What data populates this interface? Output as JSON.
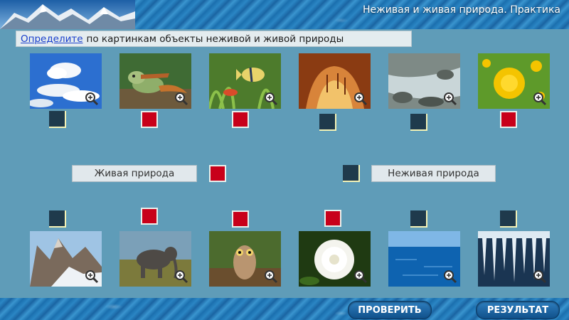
{
  "header": {
    "title": "Неживая и живая природа. Практика"
  },
  "instruction": {
    "link": "Определите",
    "text": "по картинкам объекты неживой и живой природы"
  },
  "labels": {
    "living": "Живая природа",
    "nonliving": "Неживая природа"
  },
  "legend_markers": {
    "living": "red",
    "nonliving": "dark"
  },
  "top_row": [
    {
      "name": "clouds",
      "marker": "dark"
    },
    {
      "name": "iguana",
      "marker": "red"
    },
    {
      "name": "fish",
      "marker": "red"
    },
    {
      "name": "cave",
      "marker": "dark"
    },
    {
      "name": "stream",
      "marker": "dark"
    },
    {
      "name": "dandelion",
      "marker": "red"
    }
  ],
  "bottom_row": [
    {
      "name": "mountains",
      "marker": "dark"
    },
    {
      "name": "elephant",
      "marker": "red"
    },
    {
      "name": "owl",
      "marker": "red"
    },
    {
      "name": "chrysanthemum",
      "marker": "red"
    },
    {
      "name": "sea",
      "marker": "dark"
    },
    {
      "name": "icicles",
      "marker": "dark"
    }
  ],
  "buttons": {
    "check": "ПРОВЕРИТЬ",
    "result": "РЕЗУЛЬТАТ"
  },
  "colors": {
    "background": "#5f9cb8",
    "red_marker": "#c8001a",
    "dark_marker": "#1f3a4c"
  },
  "icons": {
    "zoom": "magnifier-plus-icon"
  }
}
